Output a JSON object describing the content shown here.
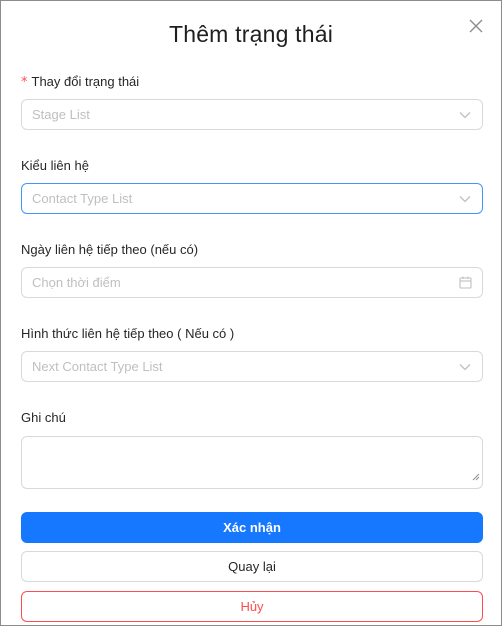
{
  "modal": {
    "title": "Thêm trạng thái",
    "close_icon": "close-icon"
  },
  "form": {
    "stage": {
      "required_mark": "*",
      "label": "Thay đổi trạng thái",
      "placeholder": "Stage List",
      "icon": "chevron-down-icon"
    },
    "contact_type": {
      "label": "Kiểu liên hệ",
      "placeholder": "Contact Type List",
      "icon": "chevron-down-icon"
    },
    "next_contact_date": {
      "label": "Ngày liên hệ tiếp theo (nếu có)",
      "placeholder": "Chọn thời điểm",
      "icon": "calendar-icon"
    },
    "next_contact_type": {
      "label": "Hình thức liên hệ tiếp theo ( Nếu có )",
      "placeholder": "Next Contact Type List",
      "icon": "chevron-down-icon"
    },
    "note": {
      "label": "Ghi chú",
      "value": ""
    }
  },
  "actions": {
    "confirm_label": "Xác nhận",
    "back_label": "Quay lại",
    "cancel_label": "Hủy"
  },
  "colors": {
    "primary": "#1677ff",
    "danger": "#ff4d4f",
    "focus_border": "#4096ff",
    "border": "#d9d9d9",
    "placeholder": "#bfbfbf"
  }
}
